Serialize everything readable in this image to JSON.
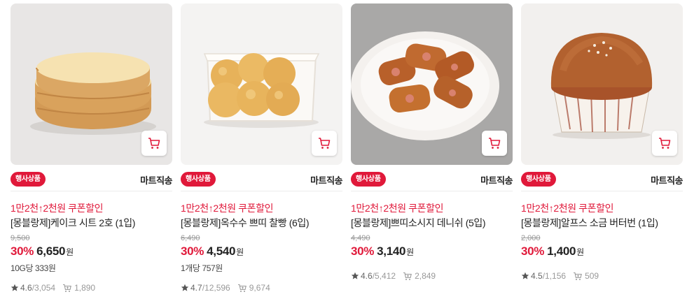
{
  "products": [
    {
      "badge": "행사상품",
      "delivery": "마트직송",
      "coupon": "1만2천↑2천원 쿠폰할인",
      "title": "[몽블랑제]케이크 시트 2호 (1입)",
      "original_price": "9,500",
      "discount_rate": "30%",
      "sale_price": "6,650",
      "currency": "원",
      "unit_price": "10G당 333원",
      "rating": "4.6",
      "review_count": "/3,054",
      "cart_count": "1,890",
      "image": "sponge-cake-sheet"
    },
    {
      "badge": "행사상품",
      "delivery": "마트직송",
      "coupon": "1만2천↑2천원 쿠폰할인",
      "title": "[몽블랑제]옥수수 쁘띠 찰빵 (6입)",
      "original_price": "6,490",
      "discount_rate": "30%",
      "sale_price": "4,540",
      "currency": "원",
      "unit_price": "1개당 757원",
      "rating": "4.7",
      "review_count": "/12,596",
      "cart_count": "9,674",
      "image": "corn-mochi-bread-tray"
    },
    {
      "badge": "행사상품",
      "delivery": "마트직송",
      "coupon": "1만2천↑2천원 쿠폰할인",
      "title": "[몽블랑제]쁘띠소시지 데니쉬 (5입)",
      "original_price": "4,490",
      "discount_rate": "30%",
      "sale_price": "3,140",
      "currency": "원",
      "unit_price": "",
      "rating": "4.6",
      "review_count": "/5,412",
      "cart_count": "2,849",
      "image": "sausage-danish-plate"
    },
    {
      "badge": "행사상품",
      "delivery": "마트직송",
      "coupon": "1만2천↑2천원 쿠폰할인",
      "title": "[몽블랑제]알프스 소금 버터번 (1입)",
      "original_price": "2,000",
      "discount_rate": "30%",
      "sale_price": "1,400",
      "currency": "원",
      "unit_price": "",
      "rating": "4.5",
      "review_count": "/1,156",
      "cart_count": "509",
      "image": "salt-butter-bun-muffin"
    }
  ],
  "colors": {
    "accent": "#e0193a",
    "text": "#222222",
    "muted": "#999999"
  },
  "icons": {
    "cart": "cart-icon",
    "star": "star-icon",
    "cart_count": "cart-count-icon"
  }
}
